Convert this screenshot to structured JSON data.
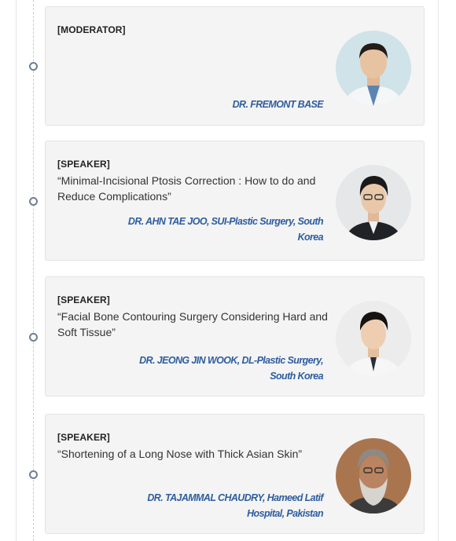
{
  "sessions": [
    {
      "role": "[MODERATOR]",
      "talk": "",
      "name": "DR. FREMONT BASE",
      "avatar_icon": "speaker-portrait"
    },
    {
      "role": "[SPEAKER]",
      "talk": "“Minimal-Incisional Ptosis Correction : How to do and Reduce Complications”",
      "name": "DR. AHN TAE JOO, SUI-Plastic Surgery, South Korea",
      "avatar_icon": "speaker-portrait"
    },
    {
      "role": "[SPEAKER]",
      "talk": "“Facial Bone Contouring Surgery Considering Hard and Soft Tissue”",
      "name": "DR. JEONG JIN WOOK, DL-Plastic Surgery, South Korea",
      "avatar_icon": "speaker-portrait"
    },
    {
      "role": "[SPEAKER]",
      "talk": "“Shortening of a Long Nose with Thick Asian Skin”",
      "name": "DR. TAJAMMAL CHAUDRY, Hameed Latif Hospital, Pakistan",
      "avatar_icon": "speaker-portrait"
    }
  ],
  "colors": {
    "name_text": "#2e5d9f",
    "card_bg": "#f4f4f4",
    "timeline_dot": "#6f7f92"
  }
}
